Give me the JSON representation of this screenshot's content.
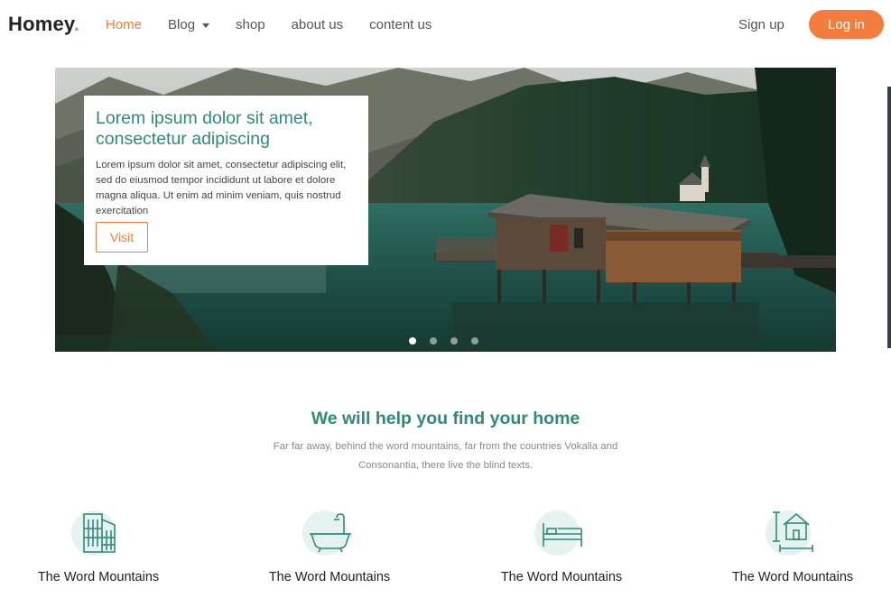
{
  "brand": {
    "name": "Homey",
    "dot": "."
  },
  "nav": {
    "items": [
      {
        "label": "Home"
      },
      {
        "label": "Blog"
      },
      {
        "label": "shop"
      },
      {
        "label": "about us"
      },
      {
        "label": "content us"
      }
    ],
    "signup": "Sign up",
    "login": "Log in"
  },
  "hero": {
    "title": "Lorem ipsum dolor sit amet, consectetur adipiscing",
    "text": "Lorem ipsum dolor sit amet, consectetur adipiscing elit, sed do eiusmod tempor incididunt ut labore et dolore magna aliqua. Ut enim ad minim veniam, quis nostrud exercitation",
    "button": "Visit",
    "slides_count": 4,
    "active_slide": 1
  },
  "section": {
    "title": "We will help you find your home",
    "subtitle": "Far far away, behind the word mountains, far from the countries Vokalia and Consonantia, there live the blind texts."
  },
  "features": [
    {
      "icon": "buildings-icon",
      "label": "The Word Mountains"
    },
    {
      "icon": "bathtub-icon",
      "label": "The Word Mountains"
    },
    {
      "icon": "bed-icon",
      "label": "The Word Mountains"
    },
    {
      "icon": "house-size-icon",
      "label": "The Word Mountains"
    }
  ],
  "colors": {
    "accent": "#f47c3c",
    "teal": "#2e8b78",
    "icon_bg": "#e6f2ef"
  }
}
